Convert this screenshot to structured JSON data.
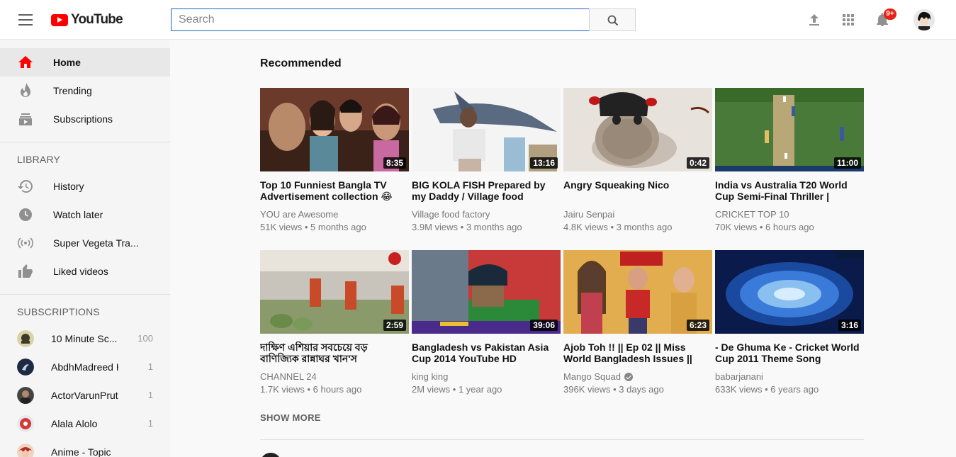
{
  "header": {
    "logo_text": "YouTube",
    "search_placeholder": "Search",
    "notification_count": "9+"
  },
  "sidebar": {
    "main_items": [
      {
        "label": "Home",
        "icon": "home-icon",
        "active": true
      },
      {
        "label": "Trending",
        "icon": "flame-icon",
        "active": false
      },
      {
        "label": "Subscriptions",
        "icon": "subscriptions-icon",
        "active": false
      }
    ],
    "library_heading": "LIBRARY",
    "library_items": [
      {
        "label": "History",
        "icon": "history-icon"
      },
      {
        "label": "Watch later",
        "icon": "clock-icon"
      },
      {
        "label": "Super Vegeta Tra...",
        "icon": "live-broadcast-icon"
      },
      {
        "label": "Liked videos",
        "icon": "thumbs-up-icon"
      }
    ],
    "subscriptions_heading": "SUBSCRIPTIONS",
    "subscriptions": [
      {
        "name": "10 Minute Sc...",
        "count": "100",
        "color": "#8a8a6a"
      },
      {
        "name": "AbdhMadreed HD",
        "count": "1",
        "color": "#2a3a55"
      },
      {
        "name": "ActorVarunPruthi",
        "count": "1",
        "color": "#3a3a3a"
      },
      {
        "name": "Alala Alolo",
        "count": "1",
        "color": "#d23a3a"
      },
      {
        "name": "Anime - Topic",
        "count": "",
        "color": "#b03020"
      }
    ]
  },
  "main": {
    "section_title": "Recommended",
    "show_more": "SHOW MORE",
    "videos": [
      {
        "title": "Top 10 Funniest Bangla TV Advertisement collection 😂",
        "channel": "YOU are Awesome",
        "views": "51K views",
        "age": "5 months ago",
        "duration": "8:35",
        "verified": false
      },
      {
        "title": "BIG KOLA FISH Prepared by my Daddy / Village food",
        "channel": "Village food factory",
        "views": "3.9M views",
        "age": "3 months ago",
        "duration": "13:16",
        "verified": false
      },
      {
        "title": "Angry Squeaking Nico",
        "channel": "Jairu Senpai",
        "views": "4.8K views",
        "age": "3 months ago",
        "duration": "0:42",
        "verified": false
      },
      {
        "title": "India vs Australia T20 World Cup Semi-Final Thriller |",
        "channel": "CRICKET TOP 10",
        "views": "70K views",
        "age": "6 hours ago",
        "duration": "11:00",
        "verified": false
      },
      {
        "title": "দাক্ষিণ এশিয়ার সবচেয়ে বড় বাণিজ্যিক রান্নাঘর খান'স",
        "channel": "CHANNEL 24",
        "views": "1.7K views",
        "age": "6 hours ago",
        "duration": "2:59",
        "verified": false
      },
      {
        "title": "Bangladesh vs Pakistan Asia Cup 2014 YouTube HD",
        "channel": "king king",
        "views": "2M views",
        "age": "1 year ago",
        "duration": "39:06",
        "verified": false
      },
      {
        "title": "Ajob Toh !! || Ep 02 || Miss World Bangladesh Issues ||",
        "channel": "Mango Squad",
        "views": "396K views",
        "age": "3 days ago",
        "duration": "6:23",
        "verified": true
      },
      {
        "title": "- De Ghuma Ke - Cricket World Cup 2011 Theme Song",
        "channel": "babarjanani",
        "views": "633K views",
        "age": "6 years ago",
        "duration": "3:16",
        "verified": false
      }
    ]
  }
}
